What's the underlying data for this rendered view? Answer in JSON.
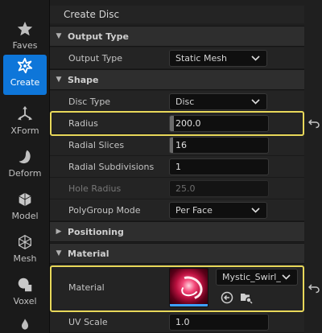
{
  "sidebar": {
    "tools": [
      {
        "label": "Faves",
        "icon": "star-icon",
        "active": false
      },
      {
        "label": "Create",
        "icon": "create-shape-icon",
        "active": true
      },
      {
        "label": "XForm",
        "icon": "transform-icon",
        "active": false
      },
      {
        "label": "Deform",
        "icon": "deform-icon",
        "active": false
      },
      {
        "label": "Model",
        "icon": "model-icon",
        "active": false
      },
      {
        "label": "Mesh",
        "icon": "mesh-icon",
        "active": false
      },
      {
        "label": "Voxel",
        "icon": "voxel-icon",
        "active": false
      }
    ]
  },
  "panel": {
    "title": "Create Disc",
    "sections": {
      "output_type": "Output Type",
      "shape": "Shape",
      "positioning": "Positioning",
      "material": "Material"
    },
    "rows": {
      "output_type": {
        "label": "Output Type",
        "value": "Static Mesh"
      },
      "disc_type": {
        "label": "Disc Type",
        "value": "Disc"
      },
      "radius": {
        "label": "Radius",
        "value": "200.0"
      },
      "radial_slices": {
        "label": "Radial Slices",
        "value": "16"
      },
      "radial_subdivisions": {
        "label": "Radial Subdivisions",
        "value": "1"
      },
      "hole_radius": {
        "label": "Hole Radius",
        "value": "25.0"
      },
      "polygroup_mode": {
        "label": "PolyGroup Mode",
        "value": "Per Face"
      },
      "material": {
        "label": "Material",
        "value": "Mystic_Swirl_"
      },
      "uv_scale": {
        "label": "UV Scale",
        "value": "1.0"
      }
    }
  },
  "colors": {
    "accent": "#0e76d9",
    "highlight": "#e8d85a"
  }
}
